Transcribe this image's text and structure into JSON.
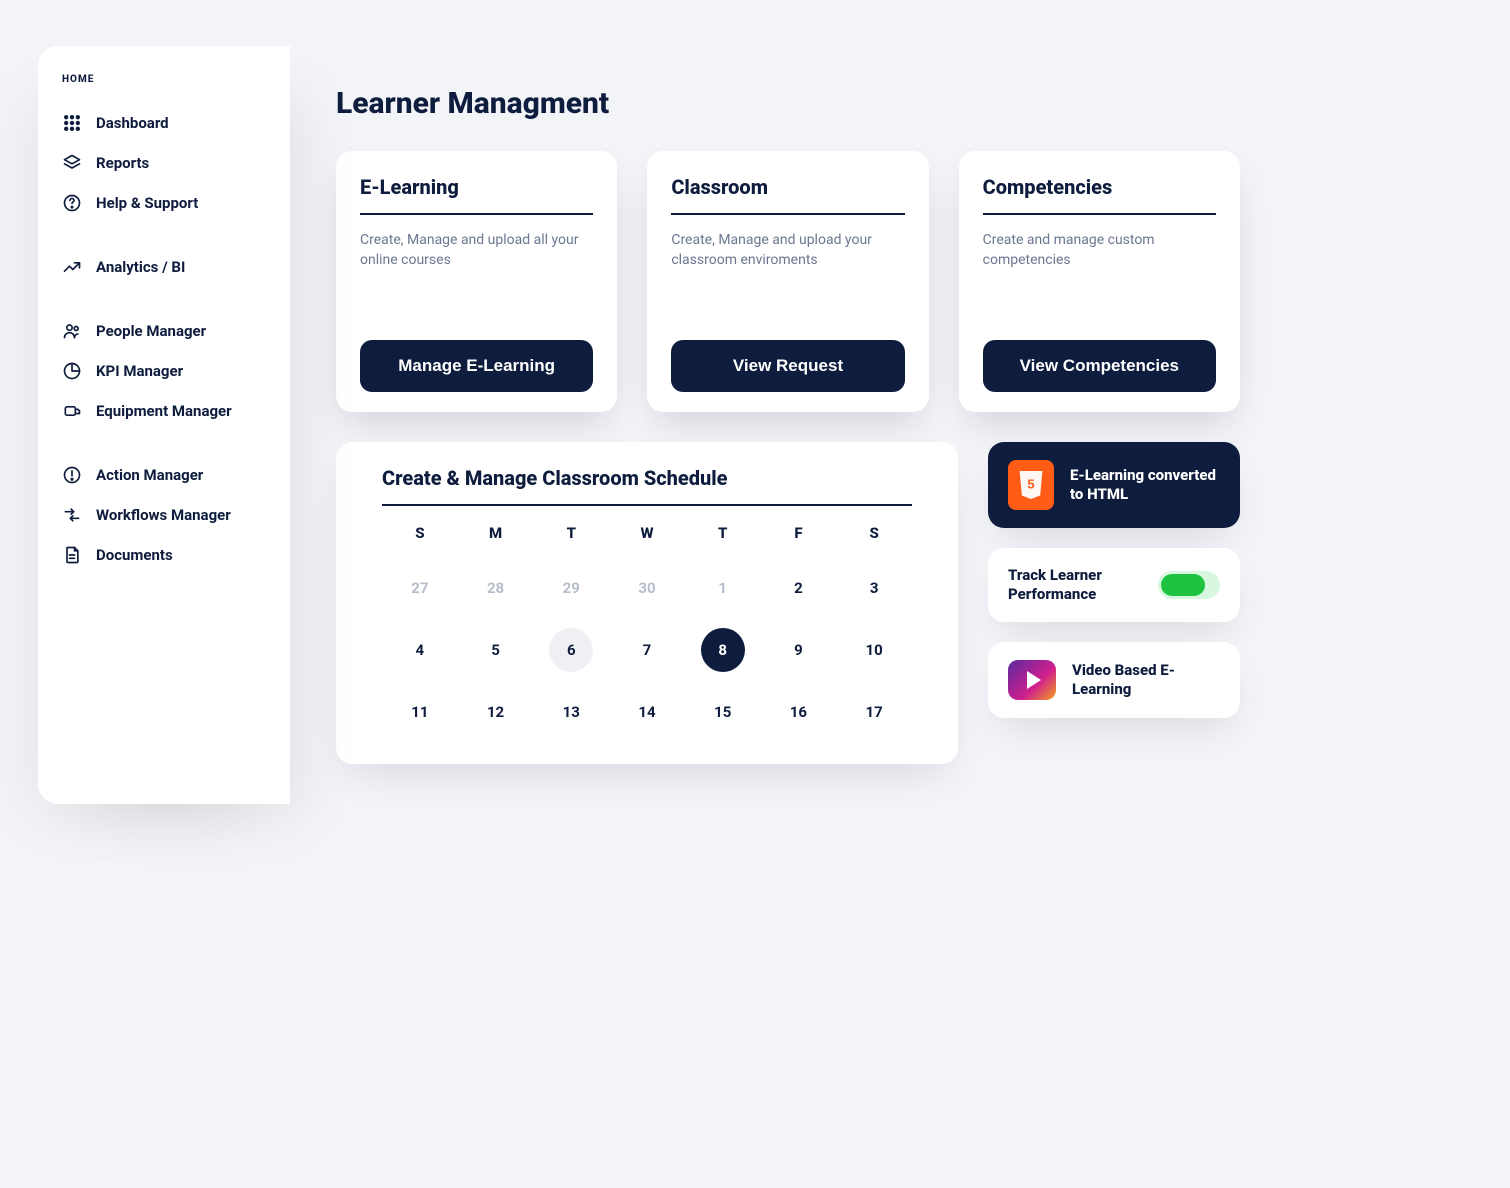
{
  "sidebar": {
    "section_label": "HOME",
    "items": [
      {
        "label": "Dashboard",
        "icon": "grid-dots-icon"
      },
      {
        "label": "Reports",
        "icon": "layers-icon"
      },
      {
        "label": "Help & Support",
        "icon": "help-circle-icon"
      },
      {
        "label": "Analytics / BI",
        "icon": "trend-up-icon"
      },
      {
        "label": "People Manager",
        "icon": "people-icon"
      },
      {
        "label": "KPI Manager",
        "icon": "pie-icon"
      },
      {
        "label": "Equipment Manager",
        "icon": "equipment-icon"
      },
      {
        "label": "Action Manager",
        "icon": "alert-circle-icon"
      },
      {
        "label": "Workflows Manager",
        "icon": "workflow-icon"
      },
      {
        "label": "Documents",
        "icon": "document-icon"
      }
    ]
  },
  "page": {
    "title": "Learner Managment"
  },
  "cards": {
    "elearning": {
      "title": "E-Learning",
      "desc": "Create, Manage and upload all your online courses",
      "cta": "Manage E-Learning"
    },
    "classroom": {
      "title": "Classroom",
      "desc": "Create, Manage and upload your classroom enviroments",
      "cta": "View Request"
    },
    "competencies": {
      "title": "Competencies",
      "desc": "Create and manage custom competencies",
      "cta": "View Competencies"
    }
  },
  "calendar": {
    "title": "Create & Manage Classroom Schedule",
    "day_headers": [
      "S",
      "M",
      "T",
      "W",
      "T",
      "F",
      "S"
    ],
    "days": [
      {
        "n": "27",
        "muted": true
      },
      {
        "n": "28",
        "muted": true
      },
      {
        "n": "29",
        "muted": true
      },
      {
        "n": "30",
        "muted": true
      },
      {
        "n": "1",
        "muted": true
      },
      {
        "n": "2"
      },
      {
        "n": "3"
      },
      {
        "n": "4"
      },
      {
        "n": "5"
      },
      {
        "n": "6",
        "today": true
      },
      {
        "n": "7"
      },
      {
        "n": "8",
        "selected": true
      },
      {
        "n": "9"
      },
      {
        "n": "10"
      },
      {
        "n": "11"
      },
      {
        "n": "12"
      },
      {
        "n": "13"
      },
      {
        "n": "14"
      },
      {
        "n": "15"
      },
      {
        "n": "16"
      },
      {
        "n": "17"
      }
    ]
  },
  "side": {
    "html": {
      "title": "E-Learning converted to HTML"
    },
    "track": {
      "title": "Track Learner Performance",
      "enabled": true
    },
    "video": {
      "title": "Video Based E-Learning"
    }
  }
}
